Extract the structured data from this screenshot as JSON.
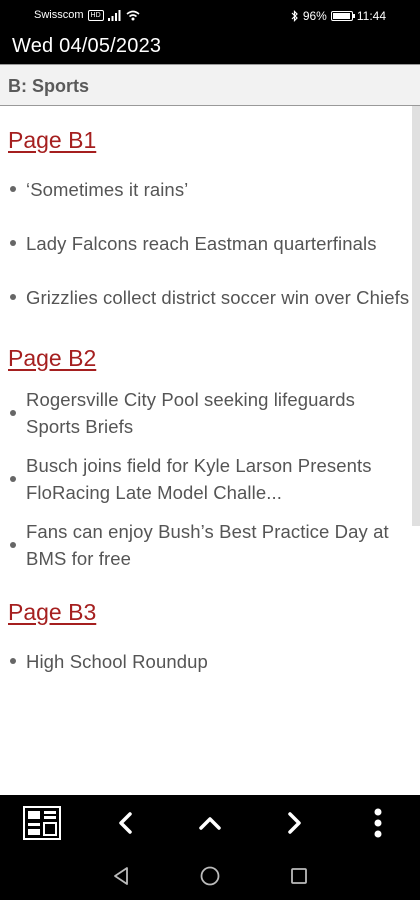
{
  "status_bar": {
    "carrier": "Swisscom",
    "network_badge": "HD",
    "battery_text": "96%",
    "battery_level": 0.96,
    "time": "11:44",
    "icons": [
      "signal-icon",
      "wifi-icon",
      "bluetooth-icon",
      "battery-icon"
    ]
  },
  "title_bar": {
    "title": "Wed 04/05/2023"
  },
  "section": {
    "title": "B: Sports"
  },
  "pages": [
    {
      "label": "Page B1",
      "articles": [
        "‘Sometimes it rains’",
        "Lady Falcons reach  Eastman quarterfinals",
        "Grizzlies collect district soccer win over Chiefs"
      ]
    },
    {
      "label": "Page B2",
      "articles": [
        "Rogersville City Pool seeking lifeguards Sports Briefs",
        "Busch joins field for Kyle Larson Presents  FloRacing Late Model Challe...",
        "Fans can enjoy Bush’s Best Practice Day at BMS for free"
      ]
    },
    {
      "label": "Page B3",
      "articles": [
        "High School Roundup"
      ]
    }
  ],
  "toolbar": {
    "buttons": [
      "pages-thumbnail-icon",
      "chevron-left-icon",
      "chevron-up-icon",
      "chevron-right-icon",
      "more-vertical-icon"
    ]
  },
  "navbar": {
    "buttons": [
      "back-icon",
      "home-icon",
      "recents-icon"
    ]
  },
  "colors": {
    "accent": "#a51f1f",
    "text": "#555555",
    "header_bg": "#f2f2f2",
    "bars": "#000000"
  }
}
